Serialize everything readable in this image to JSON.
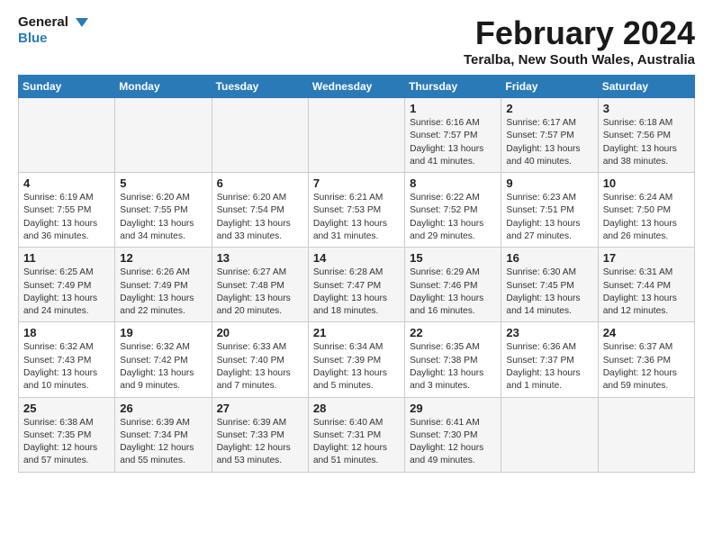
{
  "header": {
    "logo_general": "General",
    "logo_blue": "Blue",
    "month": "February 2024",
    "location": "Teralba, New South Wales, Australia"
  },
  "days_of_week": [
    "Sunday",
    "Monday",
    "Tuesday",
    "Wednesday",
    "Thursday",
    "Friday",
    "Saturday"
  ],
  "weeks": [
    [
      {
        "day": "",
        "text": ""
      },
      {
        "day": "",
        "text": ""
      },
      {
        "day": "",
        "text": ""
      },
      {
        "day": "",
        "text": ""
      },
      {
        "day": "1",
        "text": "Sunrise: 6:16 AM\nSunset: 7:57 PM\nDaylight: 13 hours\nand 41 minutes."
      },
      {
        "day": "2",
        "text": "Sunrise: 6:17 AM\nSunset: 7:57 PM\nDaylight: 13 hours\nand 40 minutes."
      },
      {
        "day": "3",
        "text": "Sunrise: 6:18 AM\nSunset: 7:56 PM\nDaylight: 13 hours\nand 38 minutes."
      }
    ],
    [
      {
        "day": "4",
        "text": "Sunrise: 6:19 AM\nSunset: 7:55 PM\nDaylight: 13 hours\nand 36 minutes."
      },
      {
        "day": "5",
        "text": "Sunrise: 6:20 AM\nSunset: 7:55 PM\nDaylight: 13 hours\nand 34 minutes."
      },
      {
        "day": "6",
        "text": "Sunrise: 6:20 AM\nSunset: 7:54 PM\nDaylight: 13 hours\nand 33 minutes."
      },
      {
        "day": "7",
        "text": "Sunrise: 6:21 AM\nSunset: 7:53 PM\nDaylight: 13 hours\nand 31 minutes."
      },
      {
        "day": "8",
        "text": "Sunrise: 6:22 AM\nSunset: 7:52 PM\nDaylight: 13 hours\nand 29 minutes."
      },
      {
        "day": "9",
        "text": "Sunrise: 6:23 AM\nSunset: 7:51 PM\nDaylight: 13 hours\nand 27 minutes."
      },
      {
        "day": "10",
        "text": "Sunrise: 6:24 AM\nSunset: 7:50 PM\nDaylight: 13 hours\nand 26 minutes."
      }
    ],
    [
      {
        "day": "11",
        "text": "Sunrise: 6:25 AM\nSunset: 7:49 PM\nDaylight: 13 hours\nand 24 minutes."
      },
      {
        "day": "12",
        "text": "Sunrise: 6:26 AM\nSunset: 7:49 PM\nDaylight: 13 hours\nand 22 minutes."
      },
      {
        "day": "13",
        "text": "Sunrise: 6:27 AM\nSunset: 7:48 PM\nDaylight: 13 hours\nand 20 minutes."
      },
      {
        "day": "14",
        "text": "Sunrise: 6:28 AM\nSunset: 7:47 PM\nDaylight: 13 hours\nand 18 minutes."
      },
      {
        "day": "15",
        "text": "Sunrise: 6:29 AM\nSunset: 7:46 PM\nDaylight: 13 hours\nand 16 minutes."
      },
      {
        "day": "16",
        "text": "Sunrise: 6:30 AM\nSunset: 7:45 PM\nDaylight: 13 hours\nand 14 minutes."
      },
      {
        "day": "17",
        "text": "Sunrise: 6:31 AM\nSunset: 7:44 PM\nDaylight: 13 hours\nand 12 minutes."
      }
    ],
    [
      {
        "day": "18",
        "text": "Sunrise: 6:32 AM\nSunset: 7:43 PM\nDaylight: 13 hours\nand 10 minutes."
      },
      {
        "day": "19",
        "text": "Sunrise: 6:32 AM\nSunset: 7:42 PM\nDaylight: 13 hours\nand 9 minutes."
      },
      {
        "day": "20",
        "text": "Sunrise: 6:33 AM\nSunset: 7:40 PM\nDaylight: 13 hours\nand 7 minutes."
      },
      {
        "day": "21",
        "text": "Sunrise: 6:34 AM\nSunset: 7:39 PM\nDaylight: 13 hours\nand 5 minutes."
      },
      {
        "day": "22",
        "text": "Sunrise: 6:35 AM\nSunset: 7:38 PM\nDaylight: 13 hours\nand 3 minutes."
      },
      {
        "day": "23",
        "text": "Sunrise: 6:36 AM\nSunset: 7:37 PM\nDaylight: 13 hours\nand 1 minute."
      },
      {
        "day": "24",
        "text": "Sunrise: 6:37 AM\nSunset: 7:36 PM\nDaylight: 12 hours\nand 59 minutes."
      }
    ],
    [
      {
        "day": "25",
        "text": "Sunrise: 6:38 AM\nSunset: 7:35 PM\nDaylight: 12 hours\nand 57 minutes."
      },
      {
        "day": "26",
        "text": "Sunrise: 6:39 AM\nSunset: 7:34 PM\nDaylight: 12 hours\nand 55 minutes."
      },
      {
        "day": "27",
        "text": "Sunrise: 6:39 AM\nSunset: 7:33 PM\nDaylight: 12 hours\nand 53 minutes."
      },
      {
        "day": "28",
        "text": "Sunrise: 6:40 AM\nSunset: 7:31 PM\nDaylight: 12 hours\nand 51 minutes."
      },
      {
        "day": "29",
        "text": "Sunrise: 6:41 AM\nSunset: 7:30 PM\nDaylight: 12 hours\nand 49 minutes."
      },
      {
        "day": "",
        "text": ""
      },
      {
        "day": "",
        "text": ""
      }
    ]
  ]
}
